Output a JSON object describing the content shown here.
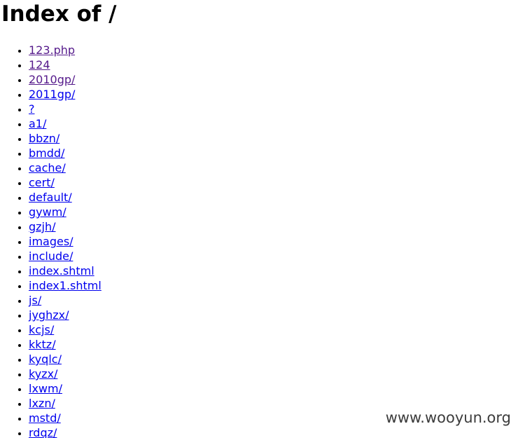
{
  "page": {
    "title": "Index of /"
  },
  "colors": {
    "link": "#0000ee",
    "visited_link": "#551a8b",
    "text": "#000000",
    "watermark": "#3c3c3c"
  },
  "listing": [
    {
      "label": "123.php",
      "visited": true
    },
    {
      "label": "124",
      "visited": true
    },
    {
      "label": "2010gp/",
      "visited": true
    },
    {
      "label": "2011gp/",
      "visited": false
    },
    {
      "label": "?",
      "visited": false
    },
    {
      "label": "a1/",
      "visited": false
    },
    {
      "label": "bbzn/",
      "visited": false
    },
    {
      "label": "bmdd/",
      "visited": false
    },
    {
      "label": "cache/",
      "visited": false
    },
    {
      "label": "cert/",
      "visited": false
    },
    {
      "label": "default/",
      "visited": false
    },
    {
      "label": "gywm/",
      "visited": false
    },
    {
      "label": "gzjh/",
      "visited": false
    },
    {
      "label": "images/",
      "visited": false
    },
    {
      "label": "include/",
      "visited": false
    },
    {
      "label": "index.shtml",
      "visited": false
    },
    {
      "label": "index1.shtml",
      "visited": false
    },
    {
      "label": "js/",
      "visited": false
    },
    {
      "label": "jyghzx/",
      "visited": false
    },
    {
      "label": "kcjs/",
      "visited": false
    },
    {
      "label": "kktz/",
      "visited": false
    },
    {
      "label": "kyqlc/",
      "visited": false
    },
    {
      "label": "kyzx/",
      "visited": false
    },
    {
      "label": "lxwm/",
      "visited": false
    },
    {
      "label": "lxzn/",
      "visited": false
    },
    {
      "label": "mstd/",
      "visited": false
    },
    {
      "label": "rdqz/",
      "visited": false
    }
  ],
  "watermark": {
    "text": "www.wooyun.org"
  }
}
